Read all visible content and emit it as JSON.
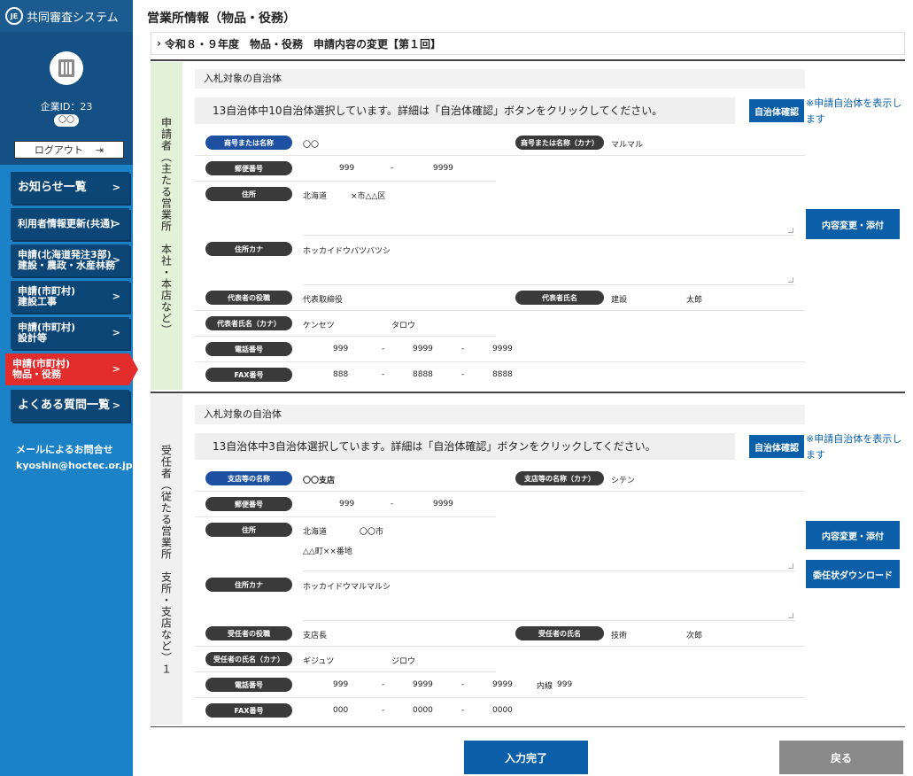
{
  "brand": {
    "logo": "JE",
    "name": "共同審査システム"
  },
  "profile": {
    "company_id": "企業ID：23",
    "company_name": "〇〇",
    "logout": "ログアウト"
  },
  "menu": [
    {
      "label": "お知らせ一覧",
      "big": true
    },
    {
      "label": "利用者情報更新(共通)"
    },
    {
      "label": "申請(北海道発注3部)\n建設・農政・水産林務"
    },
    {
      "label": "申請(市町村)\n建設工事"
    },
    {
      "label": "申請(市町村)\n設計等"
    },
    {
      "label": "申請(市町村)\n物品・役務",
      "active": true
    },
    {
      "label": "よくある質問一覧",
      "big": true
    }
  ],
  "contact": {
    "title": "メールによるお問合せ",
    "email": "kyoshin@hoctec.or.jp"
  },
  "page": {
    "title": "営業所情報（物品・役務）",
    "subtitle": "令和８・９年度　物品・役務　申請内容の変更【第１回】"
  },
  "applicant": {
    "side_label": "申請者（主たる営業所　本社・本店など）",
    "bar": "入札対象の自治体",
    "message": "13自治体中10自治体選択しています。詳細は「自治体確認」ボタンをクリックしてください。",
    "confirm_btn": "自治体確認",
    "note": "※申請自治体を表示します",
    "change_btn": "内容変更・添付",
    "fields": {
      "name_label": "商号または名称",
      "name": "〇〇",
      "kana_label": "商号または名称（カナ）",
      "kana": "マルマル",
      "zip_label": "郵便番号",
      "zip1": "999",
      "zip_dash": "-",
      "zip2": "9999",
      "addr_label": "住所",
      "addr_pref": "北海道",
      "addr_city": "×市△△区",
      "addr_kana_label": "住所カナ",
      "addr_kana": "ホッカイドウバツバツシ",
      "rep_role_label": "代表者の役職",
      "rep_role": "代表取締役",
      "rep_name_label": "代表者氏名",
      "rep_last": "建設",
      "rep_first": "太郎",
      "rep_kana_label": "代表者氏名（カナ）",
      "rep_last_kana": "ケンセツ",
      "rep_first_kana": "タロウ",
      "tel_label": "電話番号",
      "tel1": "999",
      "tel2": "9999",
      "tel3": "9999",
      "fax_label": "FAX番号",
      "fax1": "888",
      "fax2": "8888",
      "fax3": "8888",
      "dash": "-"
    }
  },
  "agent": {
    "side_label": "受任者（従たる営業所　支所・支店など）１",
    "bar": "入札対象の自治体",
    "message": "13自治体中3自治体選択しています。詳細は「自治体確認」ボタンをクリックしてください。",
    "confirm_btn": "自治体確認",
    "note": "※申請自治体を表示します",
    "change_btn": "内容変更・添付",
    "download_btn": "委任状ダウンロード",
    "fields": {
      "name_label": "支店等の名称",
      "name": "〇〇支店",
      "kana_label": "支店等の名称（カナ）",
      "kana": "シテン",
      "zip_label": "郵便番号",
      "zip1": "999",
      "zip_dash": "-",
      "zip2": "9999",
      "addr_label": "住所",
      "addr_pref": "北海道",
      "addr_city": "〇〇市",
      "addr_line2": "△△町××番地",
      "addr_kana_label": "住所カナ",
      "addr_kana": "ホッカイドウマルマルシ",
      "role_label": "受任者の役職",
      "role": "支店長",
      "pname_label": "受任者の氏名",
      "p_last": "技術",
      "p_first": "次郎",
      "pkana_label": "受任者の氏名（カナ）",
      "p_last_kana": "ギジュツ",
      "p_first_kana": "ジロウ",
      "tel_label": "電話番号",
      "tel1": "999",
      "tel2": "9999",
      "tel3": "9999",
      "ext_label": "内線",
      "ext": "999",
      "fax_label": "FAX番号",
      "fax1": "000",
      "fax2": "0000",
      "fax3": "0000",
      "dash": "-"
    }
  },
  "footer": {
    "complete": "入力完了",
    "back": "戻る"
  },
  "colors": {
    "sidebar": "#1b82c8",
    "active": "#e32d2d",
    "button": "#0b5fa8",
    "back": "#8a8a8a"
  }
}
